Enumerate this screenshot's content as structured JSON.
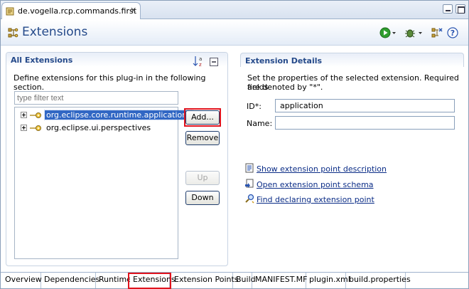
{
  "editor_tab": {
    "title": "de.vogella.rcp.commands.first",
    "close": "✕"
  },
  "header": {
    "title": "Extensions"
  },
  "all_extensions": {
    "title": "All Extensions",
    "description": "Define extensions for this plug-in in the following section.",
    "filter_placeholder": "type filter text",
    "items": [
      {
        "label": "org.eclipse.core.runtime.applications",
        "selected": true
      },
      {
        "label": "org.eclipse.ui.perspectives",
        "selected": false
      }
    ],
    "buttons": {
      "add": "Add...",
      "remove": "Remove",
      "up": "Up",
      "down": "Down"
    }
  },
  "details": {
    "title": "Extension Details",
    "description_line1": "Set the properties of the selected extension. Required fields",
    "description_line2": "are denoted by \"*\".",
    "id_label": "ID*:",
    "id_value": "application",
    "name_label": "Name:",
    "name_value": "",
    "links": [
      {
        "label": "Show extension point description",
        "icon": "doc-icon"
      },
      {
        "label": "Open extension point schema",
        "icon": "schema-icon"
      },
      {
        "label": "Find declaring extension point",
        "icon": "search-icon"
      }
    ]
  },
  "bottom_tabs": [
    "Overview",
    "Dependencies",
    "Runtime",
    "Extensions",
    "Extension Points",
    "Build",
    "MANIFEST.MF",
    "plugin.xml",
    "build.properties"
  ],
  "active_bottom_tab": "Extensions",
  "colors": {
    "title_blue": "#254a8a",
    "selection": "#3167c4",
    "highlight_red": "#e0141e",
    "link": "#0b2d87"
  }
}
